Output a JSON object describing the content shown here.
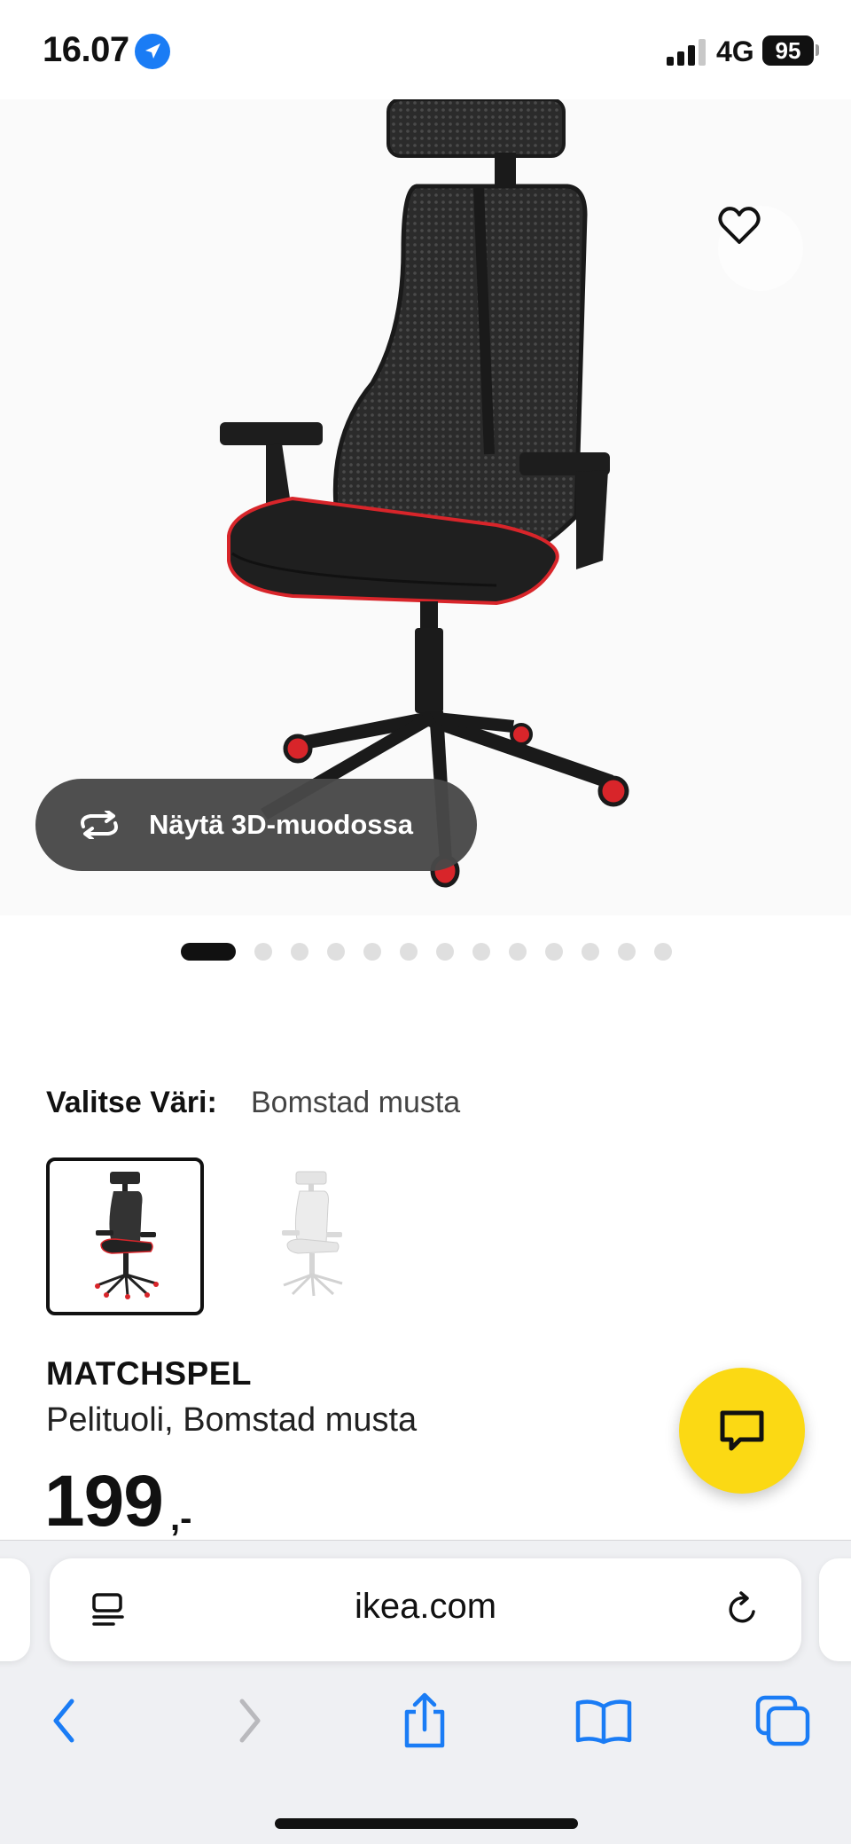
{
  "status_bar": {
    "time": "16.07",
    "network": "4G",
    "battery": "95"
  },
  "product_gallery": {
    "view_3d_label": "Näytä 3D-muodossa",
    "image_count": 13,
    "active_index": 0
  },
  "color_selector": {
    "label": "Valitse Väri:",
    "selected_value": "Bomstad musta"
  },
  "product": {
    "name": "MATCHSPEL",
    "description": "Pelituoli, Bomstad musta",
    "price": "199",
    "price_suffix": ",-"
  },
  "browser": {
    "url": "ikea.com"
  },
  "icons": {
    "location": "location-arrow-icon",
    "favorite": "heart-icon",
    "rotate": "rotate-3d-icon",
    "chat": "chat-bubble-icon",
    "page_menu": "page-menu-icon",
    "reload": "reload-icon",
    "back": "chevron-left-icon",
    "forward": "chevron-right-icon",
    "share": "share-icon",
    "bookmarks": "book-icon",
    "tabs": "tabs-icon"
  },
  "colors": {
    "chat_button": "#fbd914",
    "safari_blue": "#1a7cf5",
    "chair_accent": "#d8252a"
  }
}
